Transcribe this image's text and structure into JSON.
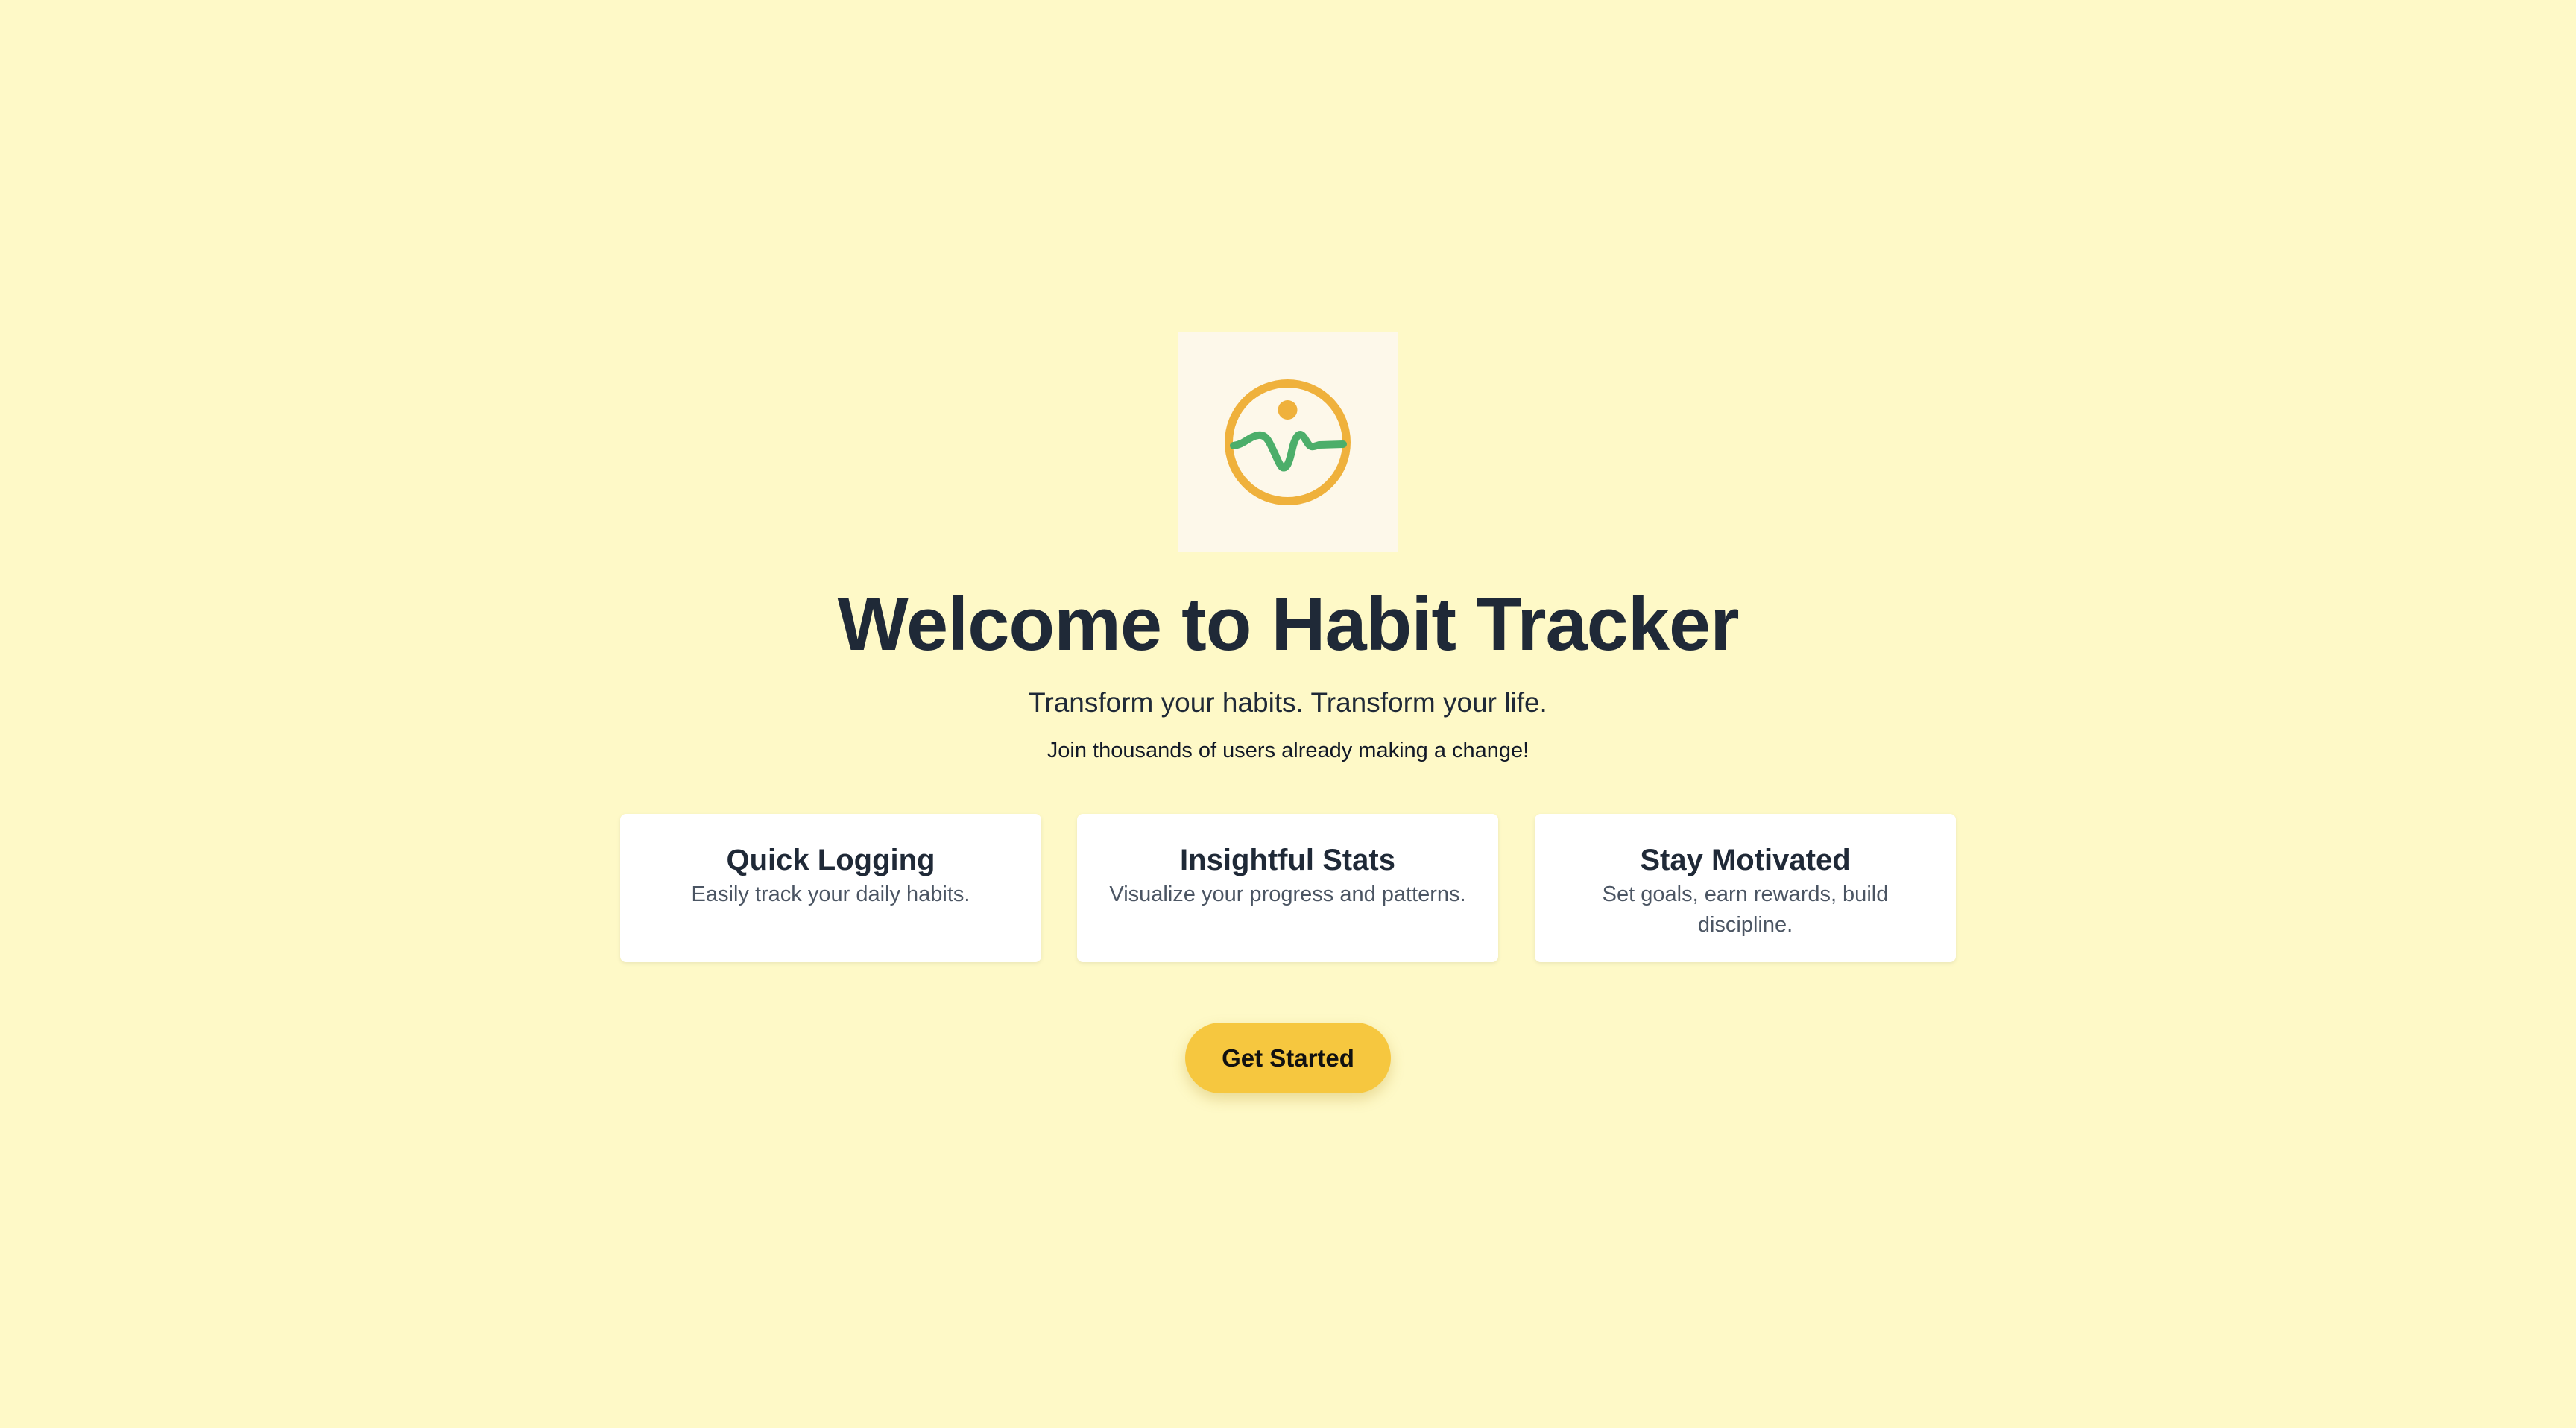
{
  "app": {
    "title": "Welcome to Habit Tracker",
    "subtitle": "Transform your habits. Transform your life.",
    "tagline": "Join thousands of users already making a change!"
  },
  "logo": {
    "icon": "habit-pulse-logo-icon",
    "colors": {
      "ring": "#efb13c",
      "dot": "#efb13c",
      "pulse": "#4cae6a",
      "background": "#fdf8ea"
    }
  },
  "features": [
    {
      "title": "Quick Logging",
      "description": "Easily track your daily habits."
    },
    {
      "title": "Insightful Stats",
      "description": "Visualize your progress and patterns."
    },
    {
      "title": "Stay Motivated",
      "description": "Set goals, earn rewards, build discipline."
    }
  ],
  "cta": {
    "label": "Get Started",
    "color": "#f6c73f"
  },
  "theme": {
    "page_background": "#fef9c7",
    "text_primary": "#1f2937",
    "text_secondary": "#4b5563"
  }
}
